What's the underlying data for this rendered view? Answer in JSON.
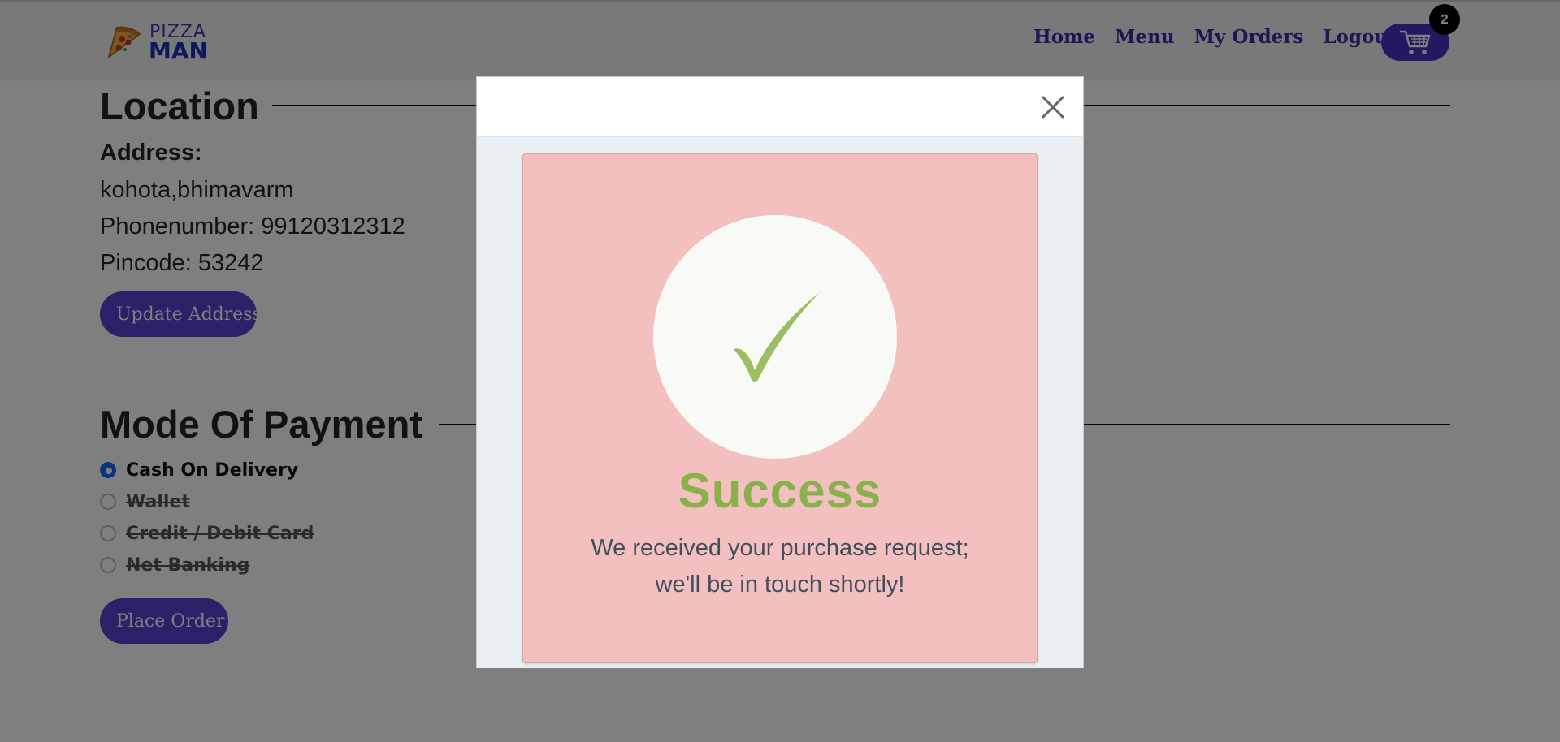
{
  "navbar": {
    "brand": {
      "line1": "PIZZA",
      "line2": "MAN"
    },
    "links": [
      "Home",
      "Menu",
      "My Orders",
      "Logout"
    ],
    "cart": {
      "badge_count": "2"
    }
  },
  "location": {
    "title": "Location",
    "address_label": "Address:",
    "address": "kohota,bhimavarm",
    "phone": "Phonenumber: 99120312312",
    "pincode": "Pincode: 53242",
    "update_button": "Update Address"
  },
  "payment": {
    "title": "Mode Of Payment",
    "options": [
      {
        "label": "Cash On Delivery",
        "selected": true,
        "disabled": false
      },
      {
        "label": "Wallet",
        "selected": false,
        "disabled": true
      },
      {
        "label": "Credit / Debit Card",
        "selected": false,
        "disabled": true
      },
      {
        "label": "Net Banking",
        "selected": false,
        "disabled": true
      }
    ],
    "place_order_button": "Place Order"
  },
  "modal": {
    "success_title": "Success",
    "message_line1": "We received your purchase request;",
    "message_line2": "we'll be in touch shortly!",
    "close_icon": "close-icon"
  },
  "colors": {
    "accent_purple": "#5a3ed0",
    "nav_link": "#3d2aa4",
    "success_green": "#88b04b",
    "card_pink": "#f4bfbf",
    "radio_blue": "#0d6efd"
  }
}
